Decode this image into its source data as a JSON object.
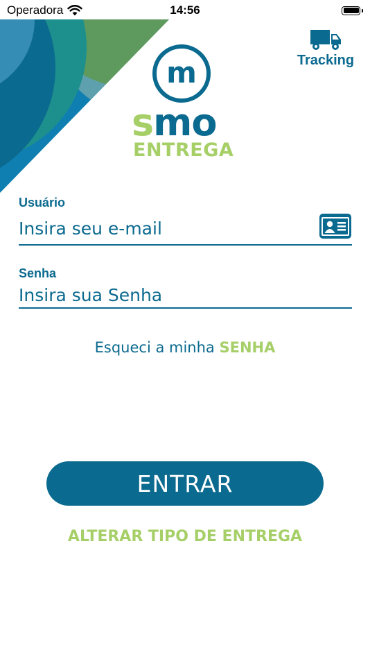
{
  "status_bar": {
    "carrier": "Operadora",
    "time": "14:56",
    "wifi_icon": "wifi-icon",
    "battery_icon": "battery-icon"
  },
  "colors": {
    "primary": "#0b6a8f",
    "accent": "#a6cf68",
    "background": "#ffffff"
  },
  "logo": {
    "monogram": "m",
    "word_s": "s",
    "word_mo": "mo",
    "subtitle": "ENTREGA"
  },
  "tracking": {
    "icon": "truck-icon",
    "label": "Tracking"
  },
  "form": {
    "user_label": "Usuário",
    "user_placeholder": "Insira seu e-mail",
    "user_icon": "id-card-icon",
    "password_label": "Senha",
    "password_placeholder": "Insira sua Senha"
  },
  "forgot": {
    "prefix": "Esqueci a minha",
    "emphasis": "SENHA"
  },
  "actions": {
    "enter_label": "ENTRAR",
    "change_type_label": "ALTERAR TIPO DE ENTREGA"
  }
}
